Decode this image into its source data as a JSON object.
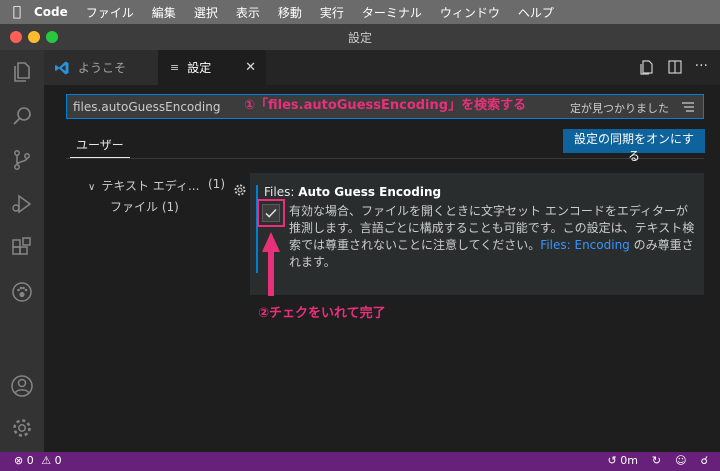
{
  "menubar": {
    "app_name": "Code",
    "items": [
      "ファイル",
      "編集",
      "選択",
      "表示",
      "移動",
      "実行",
      "ターミナル",
      "ウィンドウ",
      "ヘルプ"
    ]
  },
  "window": {
    "title": "設定"
  },
  "tabs": [
    {
      "label": "ようこそ"
    },
    {
      "label": "設定"
    }
  ],
  "search": {
    "value": "files.autoGuessEncoding",
    "result_text": "定が見つかりました"
  },
  "annotations": {
    "step1": "①「files.autoGuessEncoding」を検索する",
    "step2": "②チェクをいれて完了"
  },
  "scope": {
    "user_label": "ユーザー",
    "sync_button": "設定の同期をオンにする"
  },
  "toc": {
    "group_label": "テキスト エディ...",
    "group_count": "(1)",
    "child_label": "ファイル (1)"
  },
  "setting": {
    "category": "Files: ",
    "name": "Auto Guess Encoding",
    "checked": true,
    "description_before": "有効な場合、ファイルを開くときに文字セット エンコードをエディターが推測します。言語ごとに構成することも可能です。この設定は、テキスト検索では尊重されないことに注意してください。",
    "description_link": "Files: Encoding",
    "description_after": " のみ尊重されます。"
  },
  "status": {
    "errors": "0",
    "warnings": "0",
    "time": "0m"
  },
  "colors": {
    "accent": "#007fd4",
    "annotation": "#e8307a",
    "statusbar": "#68217a"
  }
}
